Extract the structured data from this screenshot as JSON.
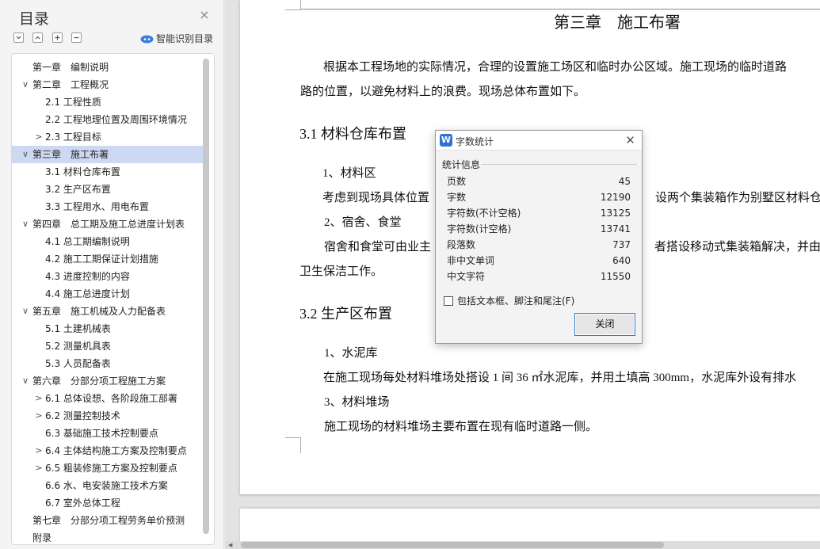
{
  "toc": {
    "title": "目录",
    "close_icon": "×",
    "smart_label": "智能识别目录",
    "items": [
      {
        "label": "第一章　编制说明",
        "level": 1,
        "arrow": ""
      },
      {
        "label": "第二章　工程概况",
        "level": 1,
        "arrow": "∨"
      },
      {
        "label": "2.1 工程性质",
        "level": 2,
        "arrow": ""
      },
      {
        "label": "2.2 工程地理位置及周围环境情况",
        "level": 2,
        "arrow": ""
      },
      {
        "label": "2.3 工程目标",
        "level": 2,
        "arrow": ">"
      },
      {
        "label": "第三章　施工布署",
        "level": 1,
        "arrow": "∨",
        "active": true
      },
      {
        "label": "3.1 材料仓库布置",
        "level": 2,
        "arrow": ""
      },
      {
        "label": "3.2  生产区布置",
        "level": 2,
        "arrow": ""
      },
      {
        "label": "3.3  工程用水、用电布置",
        "level": 2,
        "arrow": ""
      },
      {
        "label": "第四章　总工期及施工总进度计划表",
        "level": 1,
        "arrow": "∨"
      },
      {
        "label": "4.1  总工期编制说明",
        "level": 2,
        "arrow": ""
      },
      {
        "label": "4.2  施工工期保证计划措施",
        "level": 2,
        "arrow": ""
      },
      {
        "label": "4.3  进度控制的内容",
        "level": 2,
        "arrow": ""
      },
      {
        "label": "4.4  施工总进度计划",
        "level": 2,
        "arrow": ""
      },
      {
        "label": "第五章　施工机械及人力配备表",
        "level": 1,
        "arrow": "∨"
      },
      {
        "label": "5.1  土建机械表",
        "level": 2,
        "arrow": ""
      },
      {
        "label": "5.2  测量机具表",
        "level": 2,
        "arrow": ""
      },
      {
        "label": "5.3  人员配备表",
        "level": 2,
        "arrow": ""
      },
      {
        "label": "第六章　分部分项工程施工方案",
        "level": 1,
        "arrow": "∨"
      },
      {
        "label": "6.1 总体设想、各阶段施工部署",
        "level": 2,
        "arrow": ">"
      },
      {
        "label": "6.2 测量控制技术",
        "level": 2,
        "arrow": ">"
      },
      {
        "label": "6.3 基础施工技术控制要点",
        "level": 2,
        "arrow": ""
      },
      {
        "label": "6.4 主体结构施工方案及控制要点",
        "level": 2,
        "arrow": ">"
      },
      {
        "label": "6.5 粗装修施工方案及控制要点",
        "level": 2,
        "arrow": ">"
      },
      {
        "label": "6.6  水、电安装施工技术方案",
        "level": 2,
        "arrow": ""
      },
      {
        "label": "6.7 室外总体工程",
        "level": 2,
        "arrow": ""
      },
      {
        "label": "第七章　分部分项工程劳务单价预测",
        "level": 1,
        "arrow": ""
      },
      {
        "label": "附录",
        "level": 1,
        "arrow": ""
      }
    ]
  },
  "doc": {
    "chapter_title": "第三章　施工布署",
    "para1_line1": "根据本工程场地的实际情况，合理的设置施工场区和临时办公区域。施工现场的临时道路",
    "para1_line2": "路的位置，以避免材料上的浪费。现场总体布置如下。",
    "sec31": "3.1 材料仓库布置",
    "item1": "1、材料区",
    "item1_text_a": "考虑到现场具体位置",
    "item1_text_b": "设两个集装箱作为别墅区材料仓库",
    "item2": "2、宿舍、食堂",
    "item2_text_a": "宿舍和食堂可由业主",
    "item2_text_b": "者搭设移动式集装箱解决，并由",
    "item2_text_c": "卫生保洁工作。",
    "sec32": "3.2  生产区布置",
    "item3": "1、水泥库",
    "item3_text": "在施工现场每处材料堆场处搭设 1 间 36 ㎡水泥库，并用土填高 300mm，水泥库外设有排水",
    "item4": "3、材料堆场",
    "item4_text": "施工现场的材料堆场主要布置在现有临时道路一侧。"
  },
  "word_count": {
    "title": "字数统计",
    "group_label": "统计信息",
    "rows": [
      {
        "k": "页数",
        "v": "45"
      },
      {
        "k": "字数",
        "v": "12190"
      },
      {
        "k": "字符数(不计空格)",
        "v": "13125"
      },
      {
        "k": "字符数(计空格)",
        "v": "13741"
      },
      {
        "k": "段落数",
        "v": "737"
      },
      {
        "k": "非中文单词",
        "v": "640"
      },
      {
        "k": "中文字符",
        "v": "11550"
      }
    ],
    "checkbox_label": "包括文本框、脚注和尾注(F)",
    "close_button": "关闭",
    "logo": "W"
  }
}
